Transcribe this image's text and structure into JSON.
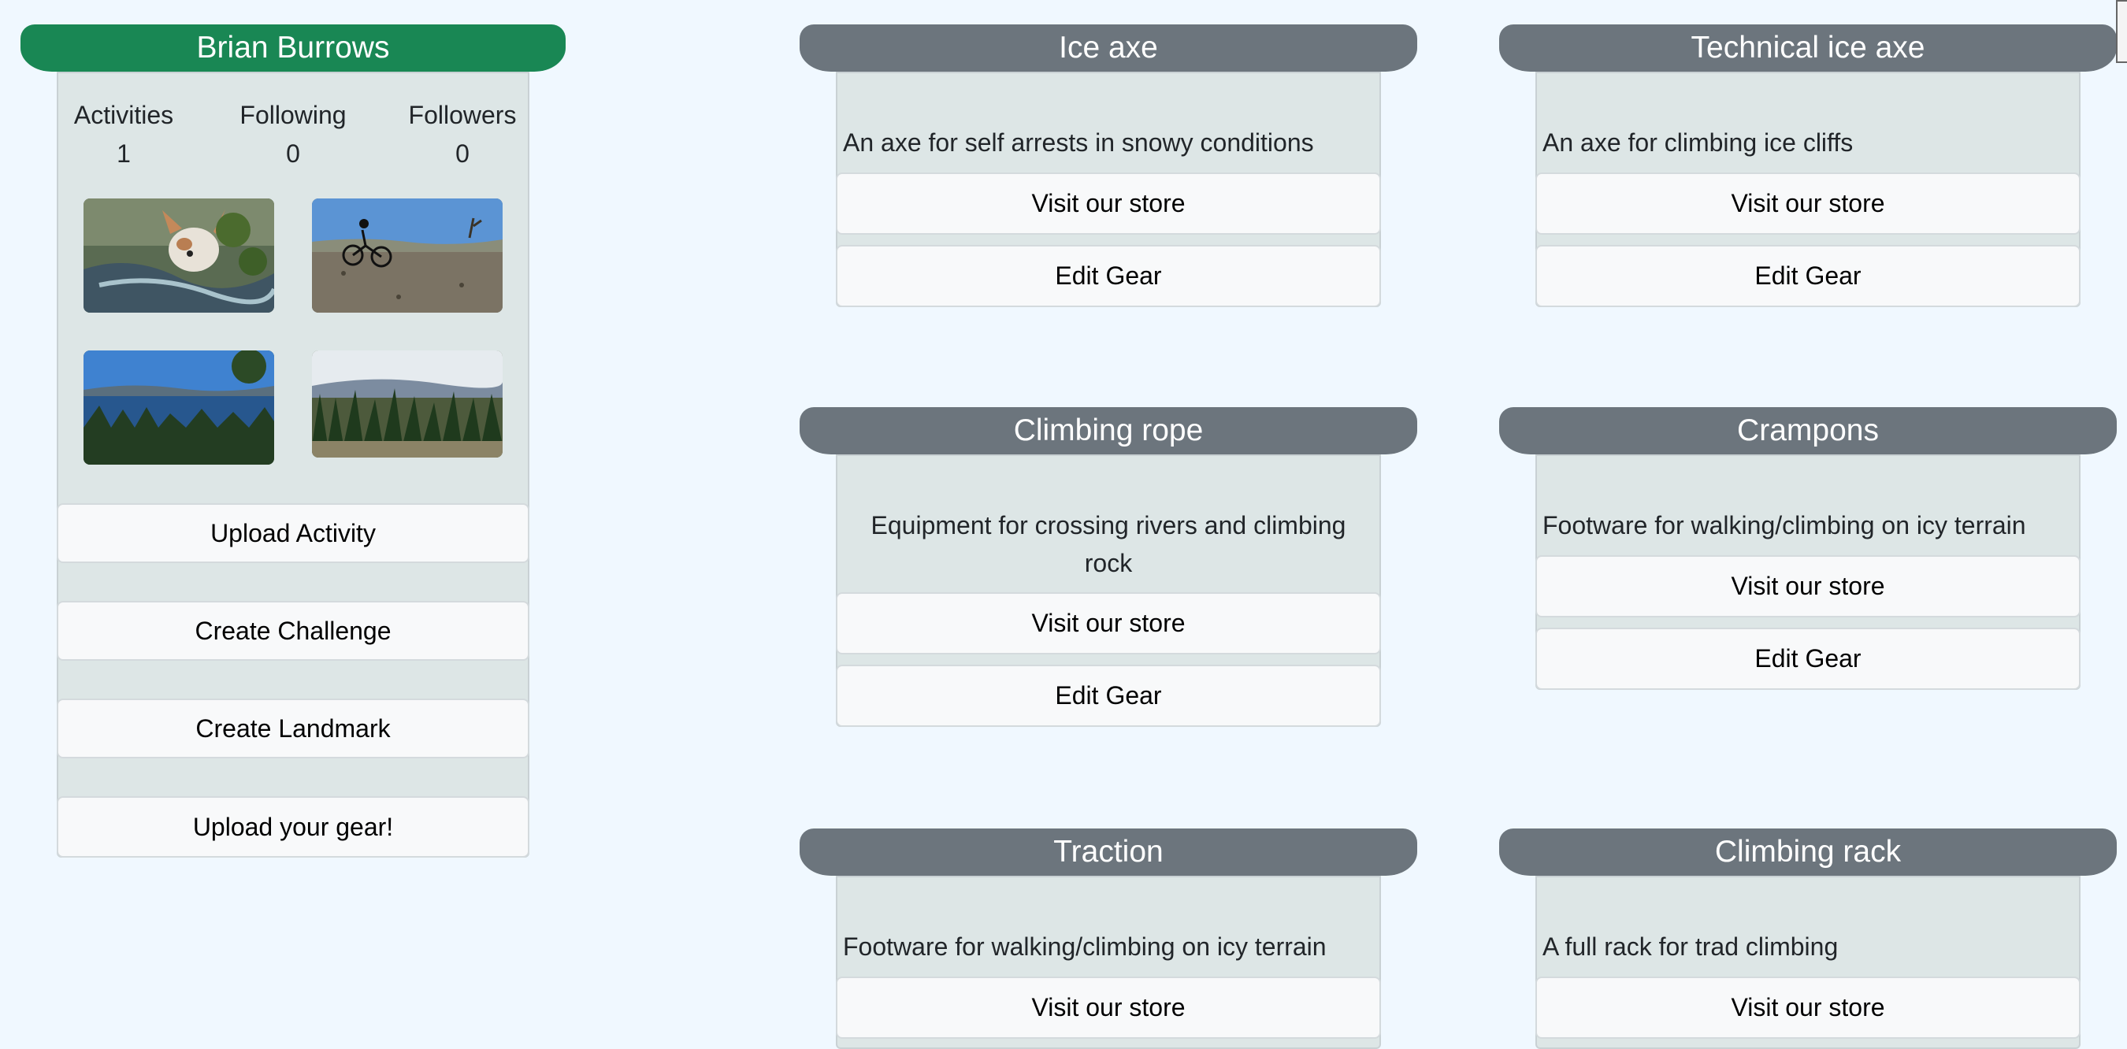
{
  "profile": {
    "name": "Brian Burrows",
    "stats": [
      {
        "label": "Activities",
        "value": "1"
      },
      {
        "label": "Following",
        "value": "0"
      },
      {
        "label": "Followers",
        "value": "0"
      }
    ],
    "buttons": {
      "upload_activity": "Upload Activity",
      "create_challenge": "Create Challenge",
      "create_landmark": "Create Landmark",
      "upload_gear": "Upload your gear!"
    }
  },
  "gear": [
    {
      "title": "Ice axe",
      "description": "An axe for self arrests in snowy conditions",
      "store_label": "Visit our store",
      "edit_label": "Edit Gear"
    },
    {
      "title": "Technical ice axe",
      "description": "An axe for climbing ice cliffs",
      "store_label": "Visit our store",
      "edit_label": "Edit Gear"
    },
    {
      "title": "Climbing rope",
      "description": "Equipment for crossing rivers and climbing rock",
      "store_label": "Visit our store",
      "edit_label": "Edit Gear"
    },
    {
      "title": "Crampons",
      "description": "Footware for walking/climbing on icy terrain",
      "store_label": "Visit our store",
      "edit_label": "Edit Gear"
    },
    {
      "title": "Traction",
      "description": "Footware for walking/climbing on icy terrain",
      "store_label": "Visit our store"
    },
    {
      "title": "Climbing rack",
      "description": "A full rack for trad climbing",
      "store_label": "Visit our store"
    }
  ],
  "colors": {
    "profile_header": "#198754",
    "gear_header": "#6c757d",
    "panel": "#dde6e6",
    "page_bg": "#f0f8ff"
  }
}
